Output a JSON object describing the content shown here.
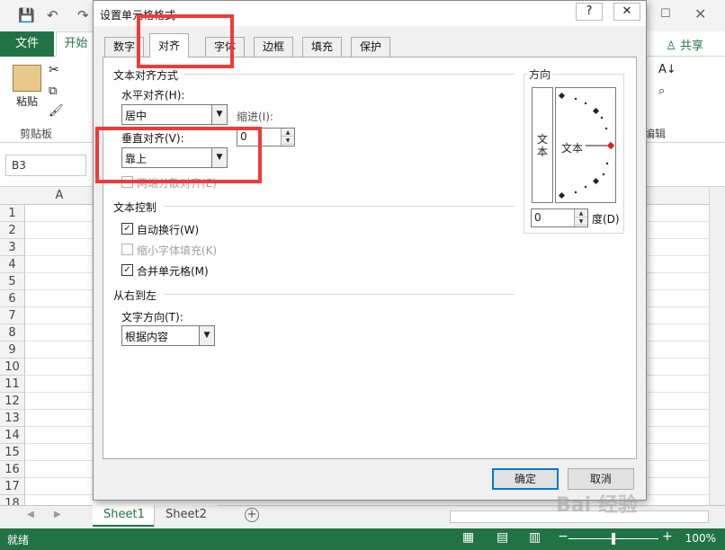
{
  "excel": {
    "ribbon_tabs": {
      "file": "文件",
      "home": "开始"
    },
    "share": "共享",
    "groups": {
      "clipboard": "剪贴板",
      "editing": "编辑"
    },
    "paste": "粘贴",
    "name_box": "B3",
    "column": "A",
    "rows": [
      "1",
      "2",
      "3",
      "4",
      "5",
      "6",
      "7",
      "8",
      "9",
      "10",
      "11",
      "12",
      "13",
      "14",
      "15",
      "16",
      "17",
      "18"
    ],
    "sheets": [
      "Sheet1",
      "Sheet2"
    ],
    "status": "就绪",
    "zoom": "100%",
    "accent_color": "#217346"
  },
  "dialog": {
    "title": "设置单元格格式",
    "help": "?",
    "tabs": [
      "数字",
      "对齐",
      "字体",
      "边框",
      "填充",
      "保护"
    ],
    "active_tab": "对齐",
    "alignment": {
      "section": "文本对齐方式",
      "horizontal_label": "水平对齐(H):",
      "horizontal_value": "居中",
      "indent_label": "缩进(I):",
      "indent_value": "0",
      "vertical_label": "垂直对齐(V):",
      "vertical_value": "靠上",
      "distributed_label": "两端分散对齐(E)"
    },
    "text_control": {
      "section": "文本控制",
      "wrap": "自动换行(W)",
      "shrink": "缩小字体填充(K)",
      "merge": "合并单元格(M)"
    },
    "rtl": {
      "section": "从右到左",
      "direction_label": "文字方向(T):",
      "direction_value": "根据内容"
    },
    "orientation": {
      "section": "方向",
      "vertical_text": "文本",
      "dial_text": "文本",
      "degrees_value": "0",
      "degrees_label": "度(D)"
    },
    "ok": "确定",
    "cancel": "取消"
  },
  "watermark": "Bai 经验"
}
